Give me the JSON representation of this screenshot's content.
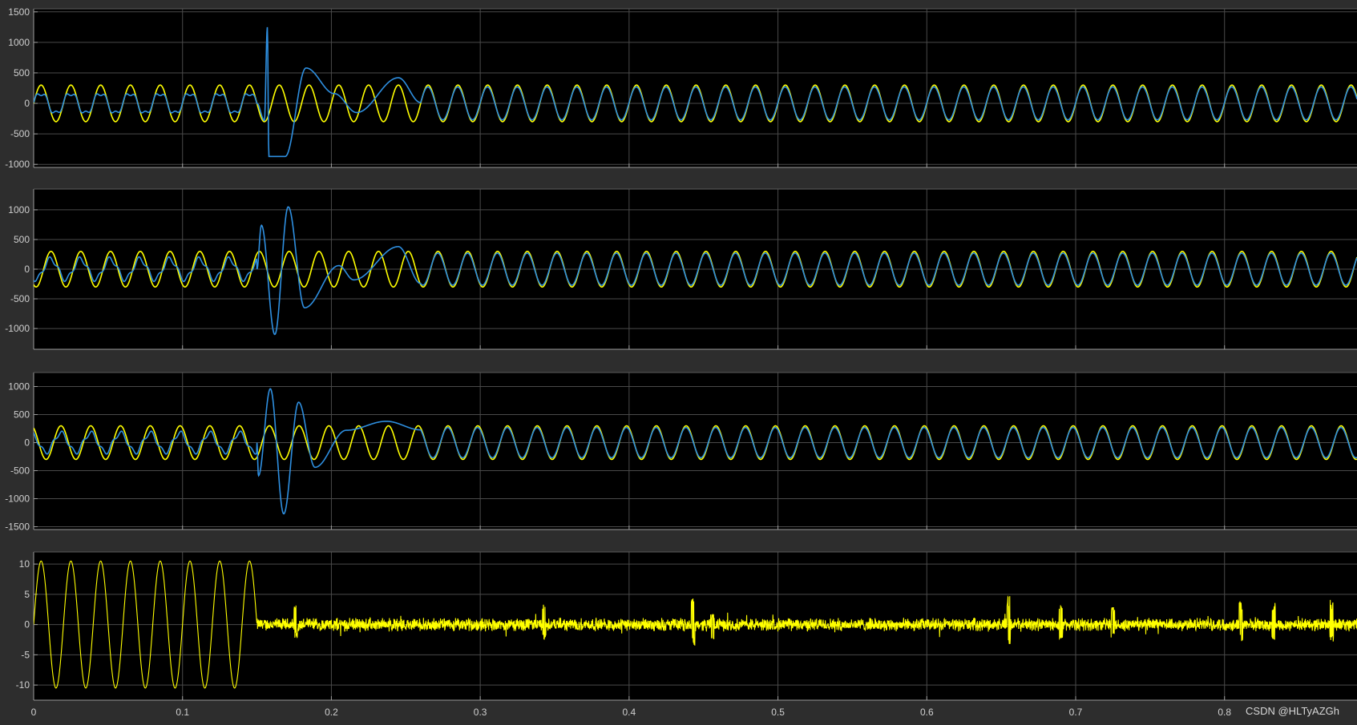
{
  "watermark": "CSDN @HLTyAZGh",
  "theme": {
    "figure_bg": "#2d2d2d",
    "axes_bg": "#000000",
    "grid_color": "#4a4a4a",
    "axis_color": "#9a9a9a",
    "tick_label_color": "#cfcfcf",
    "series_colors": [
      "#ffff00",
      "#2e8fe0"
    ]
  },
  "chart_data": [
    {
      "type": "line",
      "title": "",
      "xlabel": "",
      "ylabel": "",
      "xlim": [
        0,
        0.889
      ],
      "ylim": [
        -1050,
        1550
      ],
      "yticks": [
        1500,
        1000,
        500,
        0,
        -500,
        -1000
      ],
      "xticks": [
        0,
        0.1,
        0.2,
        0.3,
        0.4,
        0.5,
        0.6,
        0.7,
        0.8
      ],
      "grid": true,
      "series": [
        {
          "color": "#ffff00",
          "kind": "sine",
          "amplitude": 300,
          "frequency_hz": 50,
          "phase": 0
        },
        {
          "color": "#2e8fe0",
          "kind": "sine",
          "amplitude": 270,
          "frequency_hz": 50,
          "phase": 0.05,
          "pre_fault_amplitude": 170,
          "fault_start": 0.15,
          "transient_peaks": [
            [
              0.155,
              -280
            ],
            [
              0.157,
              1250
            ],
            [
              0.158,
              -870
            ],
            [
              0.169,
              -870
            ],
            [
              0.183,
              580
            ],
            [
              0.202,
              160
            ],
            [
              0.217,
              -150
            ],
            [
              0.245,
              420
            ]
          ]
        }
      ]
    },
    {
      "type": "line",
      "title": "",
      "xlabel": "",
      "ylabel": "",
      "xlim": [
        0,
        0.889
      ],
      "ylim": [
        -1350,
        1350
      ],
      "yticks": [
        1000,
        500,
        0,
        -500,
        -1000
      ],
      "xticks": [
        0,
        0.1,
        0.2,
        0.3,
        0.4,
        0.5,
        0.6,
        0.7,
        0.8
      ],
      "grid": true,
      "series": [
        {
          "color": "#ffff00",
          "kind": "sine",
          "amplitude": 300,
          "frequency_hz": 50,
          "phase": -2.09
        },
        {
          "color": "#2e8fe0",
          "kind": "sine",
          "amplitude": 270,
          "frequency_hz": 50,
          "phase": -2.04,
          "pre_fault_amplitude": 170,
          "fault_start": 0.15,
          "transient_peaks": [
            [
              0.153,
              740
            ],
            [
              0.162,
              -1100
            ],
            [
              0.171,
              1050
            ],
            [
              0.182,
              -650
            ],
            [
              0.205,
              60
            ],
            [
              0.215,
              -180
            ],
            [
              0.245,
              380
            ]
          ]
        }
      ]
    },
    {
      "type": "line",
      "title": "",
      "xlabel": "",
      "ylabel": "",
      "xlim": [
        0,
        0.889
      ],
      "ylim": [
        -1550,
        1250
      ],
      "yticks": [
        1000,
        500,
        0,
        -500,
        -1000,
        -1500
      ],
      "xticks": [
        0,
        0.1,
        0.2,
        0.3,
        0.4,
        0.5,
        0.6,
        0.7,
        0.8
      ],
      "grid": true,
      "series": [
        {
          "color": "#ffff00",
          "kind": "sine",
          "amplitude": 300,
          "frequency_hz": 50,
          "phase": 2.09
        },
        {
          "color": "#2e8fe0",
          "kind": "sine",
          "amplitude": 270,
          "frequency_hz": 50,
          "phase": 2.14,
          "pre_fault_amplitude": 170,
          "fault_start": 0.15,
          "transient_peaks": [
            [
              0.151,
              -590
            ],
            [
              0.159,
              960
            ],
            [
              0.168,
              -1270
            ],
            [
              0.178,
              720
            ],
            [
              0.189,
              -440
            ],
            [
              0.21,
              220
            ],
            [
              0.237,
              380
            ]
          ]
        }
      ]
    },
    {
      "type": "line",
      "title": "",
      "xlabel": "",
      "ylabel": "",
      "xlim": [
        0,
        0.889
      ],
      "ylim": [
        -12.5,
        12
      ],
      "yticks": [
        10,
        5,
        0,
        -5,
        -10
      ],
      "xticks": [
        0,
        0.1,
        0.2,
        0.3,
        0.4,
        0.5,
        0.6,
        0.7,
        0.8
      ],
      "xticklabels": [
        "0",
        "0.1",
        "0.2",
        "0.3",
        "0.4",
        "0.5",
        "0.6",
        "0.7",
        "0.8"
      ],
      "grid": true,
      "series": [
        {
          "color": "#ffff00",
          "kind": "sine_then_noise",
          "amplitude": 10.5,
          "frequency_hz": 50,
          "switch_time": 0.15,
          "noise_amplitude": 1.2,
          "noise_spikes": [
            [
              0.176,
              3.2
            ],
            [
              0.343,
              3.5
            ],
            [
              0.443,
              5
            ],
            [
              0.456,
              -2.5
            ],
            [
              0.655,
              4.8
            ],
            [
              0.69,
              3.5
            ],
            [
              0.725,
              3.2
            ],
            [
              0.811,
              4
            ],
            [
              0.833,
              3.6
            ],
            [
              0.872,
              4.2
            ]
          ]
        }
      ]
    }
  ]
}
